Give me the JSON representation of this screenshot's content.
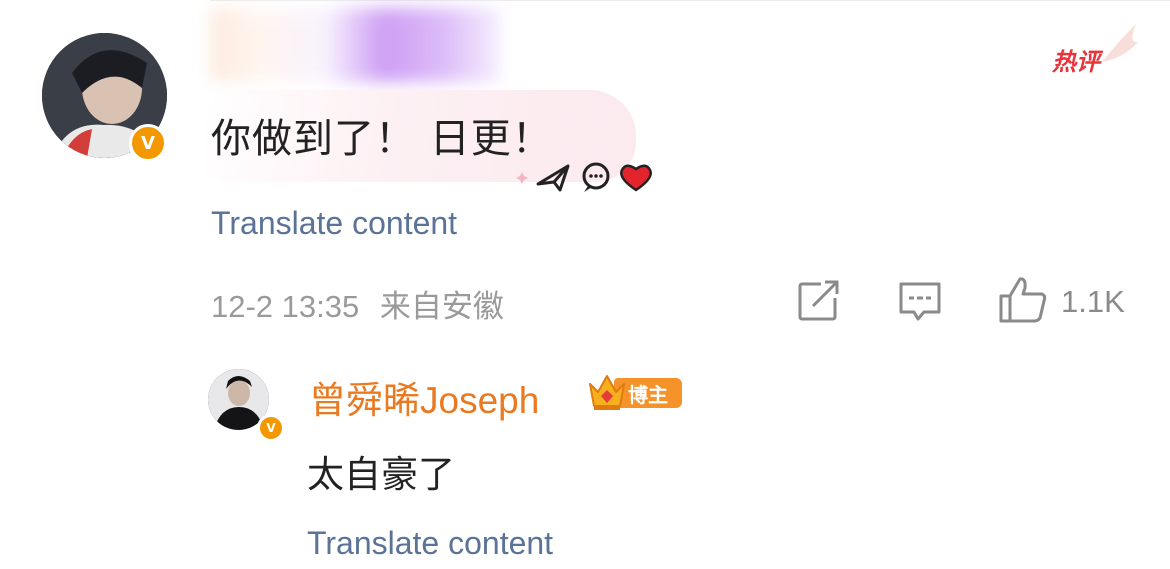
{
  "comment": {
    "hot_label": "热评",
    "text": "你做到了！ 日更！",
    "translate_label": "Translate content",
    "timestamp": "12-2 13:35",
    "location": "来自安徽",
    "like_count": "1.1K"
  },
  "reply": {
    "author": "曾舜晞Joseph",
    "badge_label": "博主",
    "text": "太自豪了",
    "translate_label": "Translate content"
  },
  "icons": {
    "verify": "V",
    "share": "share-icon",
    "comment": "comment-icon",
    "like": "thumbs-up-icon"
  },
  "colors": {
    "link": "#5a7396",
    "accent_orange": "#ea7a22",
    "hot_red": "#e8343a",
    "meta_gray": "#9a9a9a"
  }
}
